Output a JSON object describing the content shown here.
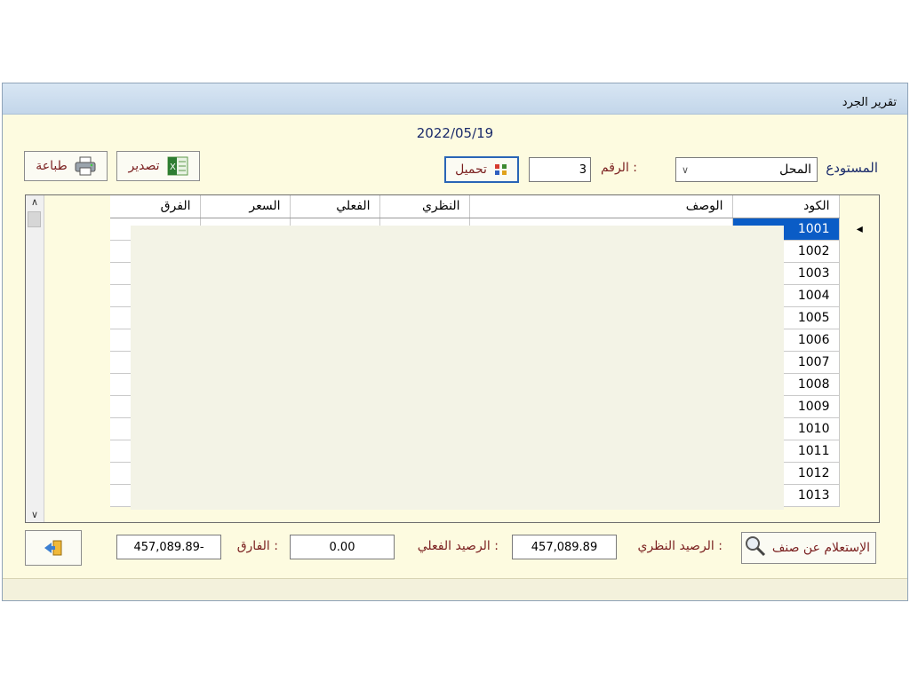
{
  "window": {
    "title": "تقرير الجرد"
  },
  "date": "2022/05/19",
  "toolbar": {
    "warehouse_label": "المستودع",
    "warehouse_value": "المحل",
    "number_label": "الرقم :",
    "number_value": "3",
    "load_label": "تحميل",
    "export_label": "تصدير",
    "print_label": "طباعة"
  },
  "table": {
    "headers": {
      "code": "الكود",
      "description": "الوصف",
      "theoretical": "النظري",
      "actual": "الفعلي",
      "price": "السعر",
      "difference": "الفرق"
    },
    "rows": [
      {
        "code": "1001"
      },
      {
        "code": "1002"
      },
      {
        "code": "1003"
      },
      {
        "code": "1004"
      },
      {
        "code": "1005"
      },
      {
        "code": "1006"
      },
      {
        "code": "1007"
      },
      {
        "code": "1008"
      },
      {
        "code": "1009"
      },
      {
        "code": "1010"
      },
      {
        "code": "1011"
      },
      {
        "code": "1012"
      },
      {
        "code": "1013"
      }
    ],
    "selected_row": 0
  },
  "footer": {
    "search_label": "الإستعلام عن صنف",
    "theoretical_balance_label": "الرصيد النظري :",
    "theoretical_balance_value": "457,089.89",
    "actual_balance_label": "الرصيد الفعلي :",
    "actual_balance_value": "0.00",
    "difference_label": "الفارق :",
    "difference_value": "457,089.89-"
  },
  "icons": {
    "print": "printer-icon",
    "export": "excel-icon",
    "load": "load-icon",
    "search": "magnifier-icon",
    "exit": "exit-icon",
    "dropdown": "chevron-down-icon"
  }
}
